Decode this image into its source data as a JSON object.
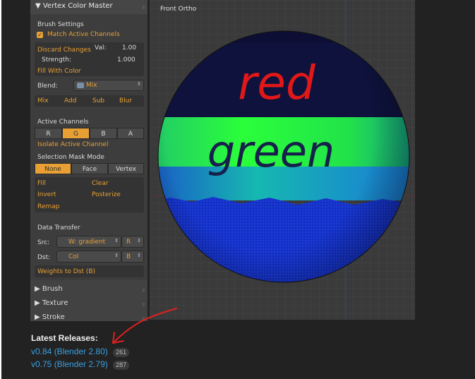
{
  "panel": {
    "title": "▼ Vertex Color Master",
    "brush_settings": "Brush Settings",
    "match_channels": "Match Active Channels",
    "discard_changes": "Discard Changes",
    "val_label": "Val:",
    "val_value": "1.00",
    "strength_label": "Strength:",
    "strength_value": "1.000",
    "fill_with_color": "Fill With Color",
    "blend_label": "Blend:",
    "blend_value": "Mix",
    "blend_modes": [
      "Mix",
      "Add",
      "Sub",
      "Blur"
    ],
    "active_channels": "Active Channels",
    "channels": [
      "R",
      "G",
      "B",
      "A"
    ],
    "isolate_channel": "Isolate Active Channel",
    "selection_mask": "Selection Mask Mode",
    "mask_modes": [
      "None",
      "Face",
      "Vertex"
    ],
    "ops": [
      "Fill",
      "Clear",
      "Invert",
      "Posterize",
      "Remap"
    ],
    "data_transfer": "Data Transfer",
    "src_label": "Src:",
    "src_value": "W: gradient",
    "src_channel": "R",
    "dst_label": "Dst:",
    "dst_value": "Col",
    "dst_channel": "B",
    "weights_to_dst": "Weights to Dst (B)",
    "collapsed": [
      "▶ Brush",
      "▶ Texture",
      "▶ Stroke"
    ]
  },
  "viewport": {
    "title": "Front Ortho",
    "sphere_text_top": "red",
    "sphere_text_mid": "green"
  },
  "releases": {
    "heading": "Latest Releases",
    "items": [
      {
        "label": "v0.84 (Blender 2.80)",
        "count": "261"
      },
      {
        "label": "v0.75 (Blender 2.79)",
        "count": "287"
      }
    ]
  },
  "colors": {
    "accent": "#e8a035",
    "link": "#3aa0e0",
    "annotation": "#e02020"
  }
}
